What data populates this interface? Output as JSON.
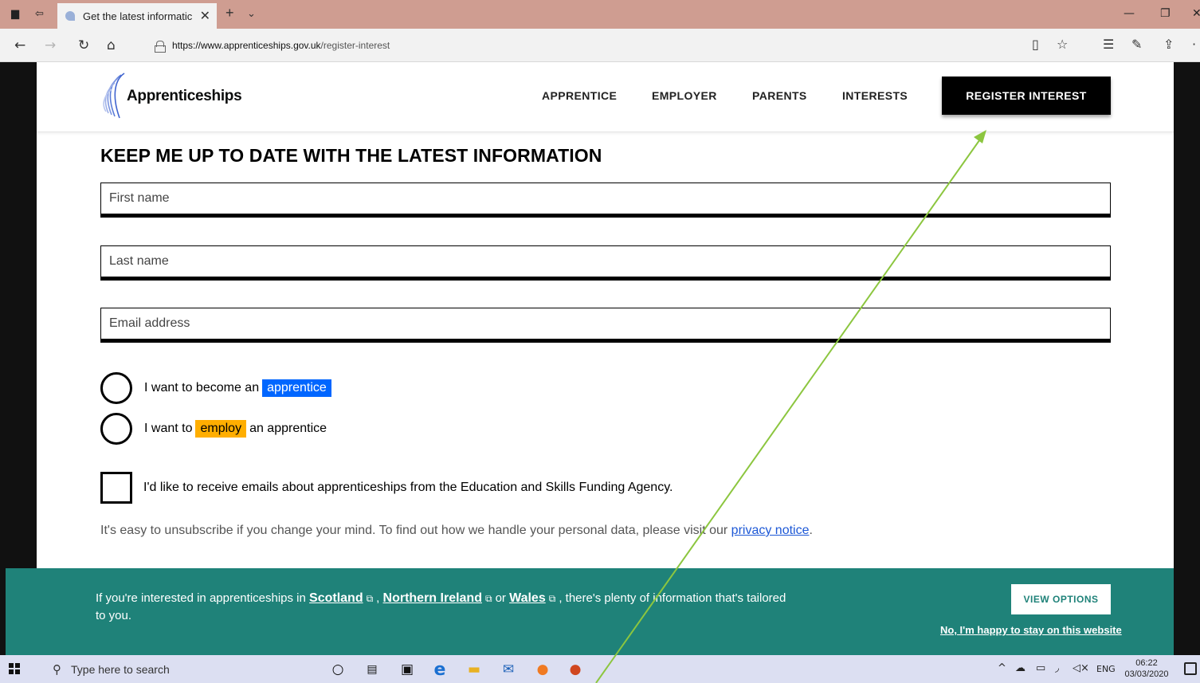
{
  "browser": {
    "tab_title": "Get the latest informatic",
    "url_host": "https://www.apprenticeships.gov.uk",
    "url_path": "/register-interest"
  },
  "site": {
    "logo_text": "Apprenticeships",
    "nav": [
      "APPRENTICE",
      "EMPLOYER",
      "PARENTS",
      "INTERESTS"
    ],
    "register_button": "REGISTER INTEREST"
  },
  "form": {
    "heading": "KEEP ME UP TO DATE WITH THE LATEST INFORMATION",
    "first_name_placeholder": "First name",
    "last_name_placeholder": "Last name",
    "email_placeholder": "Email address",
    "radio_apprentice": {
      "pre": "I want to become an",
      "highlight": "apprentice"
    },
    "radio_employer": {
      "pre": "I want to",
      "highlight": "employ",
      "post": "an apprentice"
    },
    "checkbox_label": "I'd like to receive emails about apprenticeships from the Education and Skills Funding Agency.",
    "note_text": "It's easy to unsubscribe if you change your mind. To find out how we handle your personal data, please visit our",
    "note_link": "privacy notice",
    "note_end": "."
  },
  "banner": {
    "pre": "If you're interested in apprenticeships in",
    "scotland": "Scotland",
    "comma": ",",
    "ni": "Northern Ireland",
    "or": "or",
    "wales": "Wales",
    "post": ", there's plenty of information that's tailored to you.",
    "view_button": "VIEW OPTIONS",
    "stay_link": "No, I'm happy to stay on this website"
  },
  "taskbar": {
    "search_placeholder": "Type here to search",
    "lang": "ENG",
    "time": "06:22",
    "date": "03/03/2020"
  },
  "colors": {
    "banner": "#1f8279",
    "apprentice_highlight": "#0066ff",
    "employ_highlight": "#ffae00",
    "annotation_arrow": "#8cc63f"
  }
}
